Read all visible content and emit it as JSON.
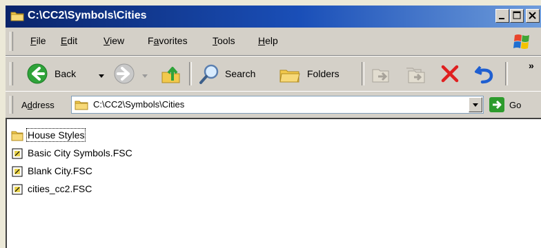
{
  "window": {
    "title": "C:\\CC2\\Symbols\\Cities"
  },
  "menu": {
    "items": [
      {
        "label": "File",
        "key": "F",
        "rest": "ile"
      },
      {
        "label": "Edit",
        "key": "E",
        "rest": "dit"
      },
      {
        "label": "View",
        "key": "V",
        "rest": "iew"
      },
      {
        "label": "Favorites",
        "pre": "F",
        "key": "a",
        "rest": "vorites"
      },
      {
        "label": "Tools",
        "key": "T",
        "rest": "ools"
      },
      {
        "label": "Help",
        "key": "H",
        "rest": "elp"
      }
    ]
  },
  "toolbar": {
    "back_label": "Back",
    "search_label": "Search",
    "folders_label": "Folders",
    "chevron": "»",
    "icons": [
      "back-arrow-icon",
      "forward-arrow-icon",
      "up-folder-icon",
      "search-magnifier-icon",
      "folders-icon",
      "move-to-icon",
      "copy-to-icon",
      "delete-x-icon",
      "undo-icon"
    ]
  },
  "address": {
    "label_pre": "A",
    "label_key": "d",
    "label_rest": "dress",
    "value": "C:\\CC2\\Symbols\\Cities",
    "go_label": "Go"
  },
  "files": {
    "items": [
      {
        "name": "House Styles",
        "type": "folder"
      },
      {
        "name": "Basic City Symbols.FSC",
        "type": "file"
      },
      {
        "name": "Blank City.FSC",
        "type": "file"
      },
      {
        "name": "cities_cc2.FSC",
        "type": "file"
      }
    ]
  },
  "colors": {
    "titlebar": "#0a246a",
    "chrome": "#d4d0c8",
    "go": "#2d9b2d",
    "delete": "#e02020"
  }
}
